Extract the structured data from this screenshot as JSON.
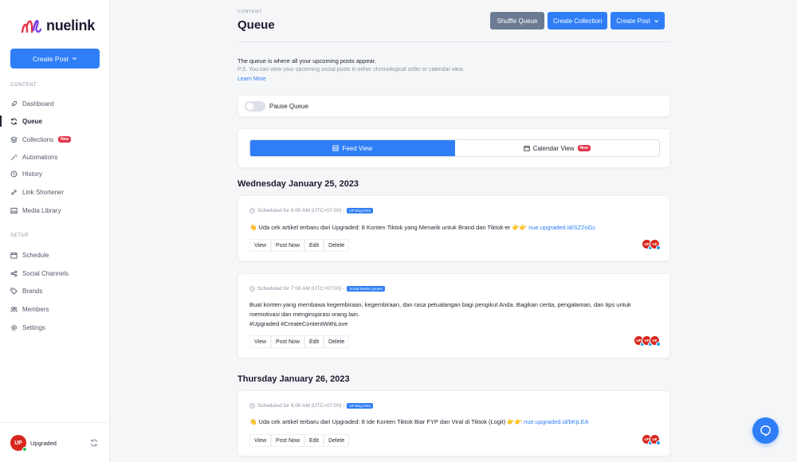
{
  "brand": {
    "name": "nuelink",
    "accent": "#2f7ef7",
    "danger": "#e5344c"
  },
  "sidebar": {
    "create_post": "Create Post",
    "content_label": "CONTENT",
    "setup_label": "SETUP",
    "content_items": [
      {
        "label": "Dashboard",
        "icon": "rocket-icon"
      },
      {
        "label": "Queue",
        "icon": "refresh-icon",
        "active": true
      },
      {
        "label": "Collections",
        "icon": "layers-icon",
        "badge": "New"
      },
      {
        "label": "Automations",
        "icon": "magic-wand-icon"
      },
      {
        "label": "History",
        "icon": "history-icon"
      },
      {
        "label": "Link Shortener",
        "icon": "link-icon"
      },
      {
        "label": "Media Library",
        "icon": "image-icon"
      }
    ],
    "setup_items": [
      {
        "label": "Schedule",
        "icon": "calendar-icon"
      },
      {
        "label": "Social Channels",
        "icon": "share-icon"
      },
      {
        "label": "Brands",
        "icon": "tag-icon"
      },
      {
        "label": "Members",
        "icon": "users-icon"
      },
      {
        "label": "Settings",
        "icon": "gear-icon"
      }
    ],
    "footer": {
      "avatar_text": "UP",
      "user_name": "Upgraded"
    }
  },
  "header": {
    "breadcrumb": "CONTENT",
    "title": "Queue",
    "shuffle": "Shuffle Queue",
    "create_collection": "Create Collection",
    "create_post": "Create Post"
  },
  "intro": {
    "title": "The queue is where all your upcoming posts appear.",
    "note": "P.S. You can view your upcoming social posts in either chronological order or calendar view.",
    "learn_more": "Learn More"
  },
  "pause": {
    "label": "Pause Queue",
    "enabled": false
  },
  "views": {
    "feed": "Feed View",
    "calendar": "Calendar View",
    "calendar_badge": "New"
  },
  "days": [
    {
      "date": "Wednesday January 25, 2023",
      "posts": [
        {
          "scheduled": "Scheduled for 6:00 AM (UTC+07:00) -",
          "tag": "UP Blog RSS",
          "text": "👋 Uda cek artikel terbaru dari Upgraded: 8 Konten Tiktok yang Menarik untuk Brand dan Tiktok-er 👉👉",
          "link": "nue.upgraded.id/SZ2oGc",
          "channels": 2
        },
        {
          "scheduled": "Scheduled for 7:00 AM (UTC+07:00) -",
          "tag": "Social Media Quotes",
          "text_lines": [
            "Buat konten yang membawa kegembiraan, kegembiraan, dan rasa petualangan bagi pengikut Anda. Bagikan cerita, pengalaman, dan tips untuk",
            "memotivasi dan menginspirasi orang lain.",
            "#Upgraded #CreateContentWithLove"
          ],
          "channels": 3
        }
      ]
    },
    {
      "date": "Thursday January 26, 2023",
      "posts": [
        {
          "scheduled": "Scheduled for 6:00 AM (UTC+07:00) -",
          "tag": "UP Blog RSS",
          "text": "👋 Uda cek artikel terbaru dari Upgraded: 8 Ide Konten Tiktok Biar FYP dan Viral di Tiktok (Logit) 👉👉",
          "link": "nue.upgraded.id/bKjLEA",
          "channels": 2
        }
      ]
    }
  ],
  "post_actions": {
    "view": "View",
    "post_now": "Post Now",
    "edit": "Edit",
    "delete": "Delete"
  },
  "channel_avatar_text": "UP"
}
